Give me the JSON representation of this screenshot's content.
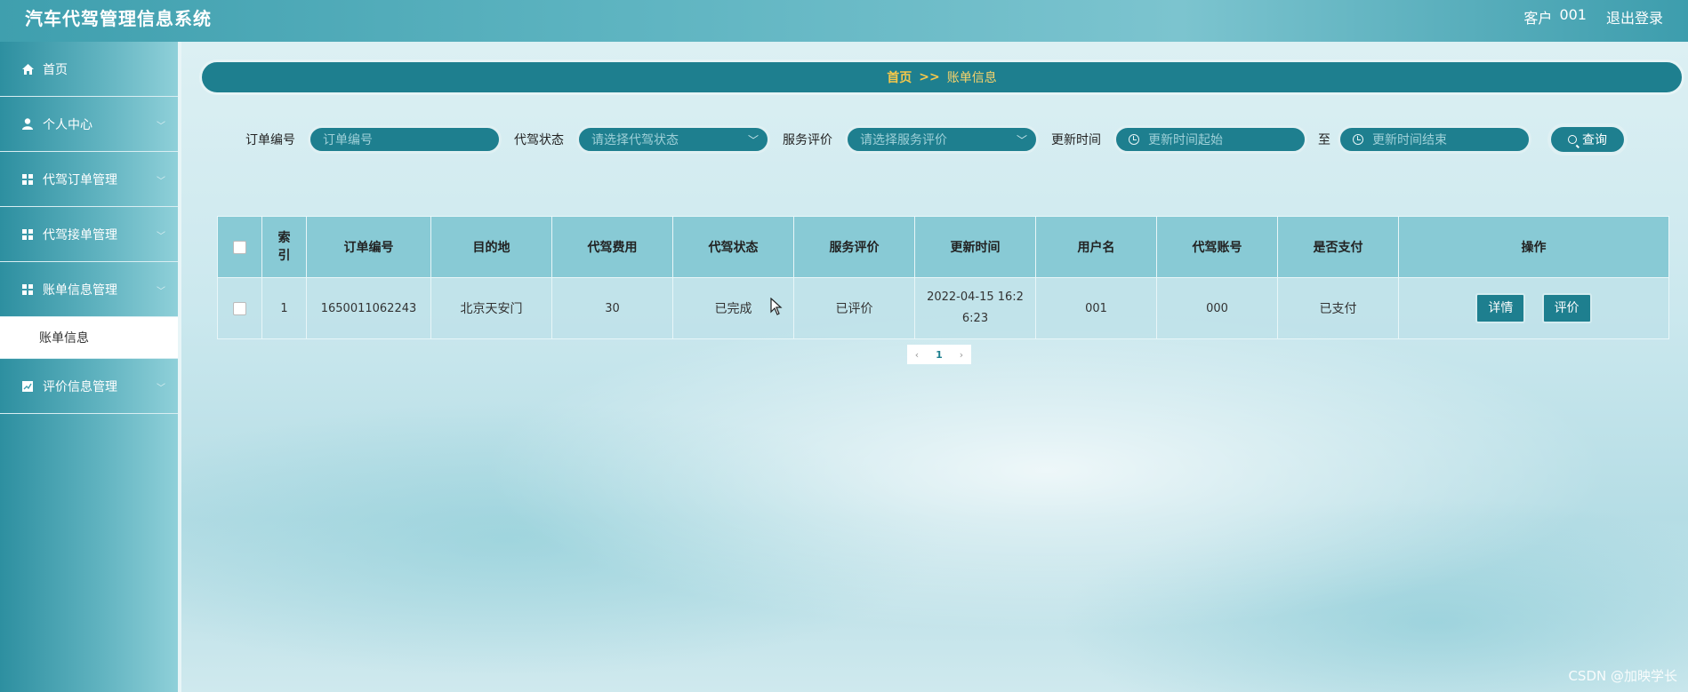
{
  "header": {
    "title": "汽车代驾管理信息系统",
    "user_role": "客户",
    "user_name": "001",
    "logout": "退出登录"
  },
  "sidebar": {
    "items": [
      {
        "label": "首页",
        "icon": "home-icon"
      },
      {
        "label": "个人中心",
        "icon": "user-icon"
      },
      {
        "label": "代驾订单管理",
        "icon": "grid-icon"
      },
      {
        "label": "代驾接单管理",
        "icon": "grid-icon"
      },
      {
        "label": "账单信息管理",
        "icon": "grid-icon"
      },
      {
        "label": "评价信息管理",
        "icon": "chart-icon"
      }
    ],
    "active_sub": "账单信息"
  },
  "breadcrumb": {
    "home": "首页",
    "separator": ">>",
    "current": "账单信息"
  },
  "search": {
    "order_no_label": "订单编号",
    "order_no_placeholder": "订单编号",
    "status_label": "代驾状态",
    "status_placeholder": "请选择代驾状态",
    "review_label": "服务评价",
    "review_placeholder": "请选择服务评价",
    "time_label": "更新时间",
    "time_start_placeholder": "更新时间起始",
    "to": "至",
    "time_end_placeholder": "更新时间结束",
    "query_button": "查询"
  },
  "table": {
    "headers": [
      "索引",
      "订单编号",
      "目的地",
      "代驾费用",
      "代驾状态",
      "服务评价",
      "更新时间",
      "用户名",
      "代驾账号",
      "是否支付",
      "操作"
    ],
    "rows": [
      {
        "index": "1",
        "order_no": "1650011062243",
        "destination": "北京天安门",
        "fee": "30",
        "status": "已完成",
        "review": "已评价",
        "updated": "2022-04-15 16:26:23",
        "username": "001",
        "driver_account": "000",
        "paid": "已支付",
        "action_detail": "详情",
        "action_review": "评价"
      }
    ]
  },
  "pagination": {
    "prev": "‹",
    "current": "1",
    "next": "›"
  },
  "watermark": "CSDN @加映学长",
  "colors": {
    "primary": "#1e7f8f",
    "accent": "#f6c84a"
  }
}
